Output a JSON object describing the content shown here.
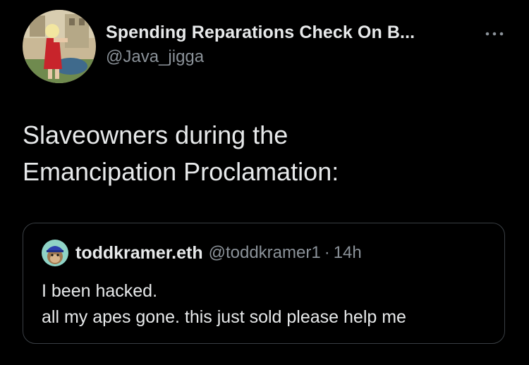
{
  "tweet": {
    "author": {
      "display_name": "Spending Reparations Check On B...",
      "handle": "@Java_jigga"
    },
    "text_lines": [
      "Slaveowners during the",
      "Emancipation Proclamation:"
    ],
    "more_icon": "more-horizontal-icon"
  },
  "quote": {
    "author": {
      "display_name": "toddkramer.eth",
      "handle": "@toddkramer1",
      "separator": "·",
      "time": "14h"
    },
    "text_lines": [
      "I been hacked.",
      "all my apes gone. this just sold please help me"
    ]
  },
  "colors": {
    "background": "#000000",
    "primary_text": "#e7e9ea",
    "secondary_text": "#8b9299",
    "border": "#3a3f44"
  }
}
